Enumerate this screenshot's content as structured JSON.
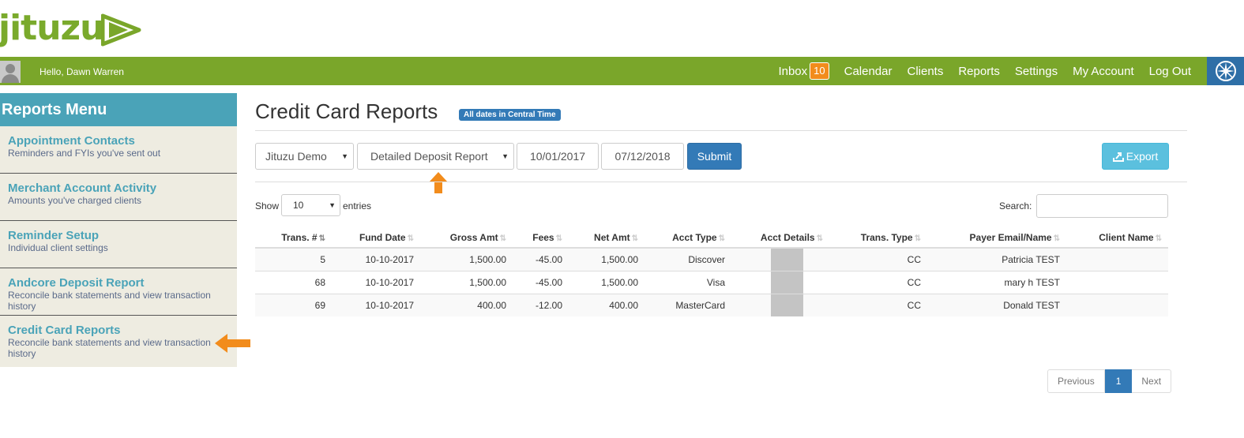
{
  "brand": {
    "logo_text": "jituzu",
    "accent": "#7aa62a"
  },
  "header": {
    "greeting": "Hello, Dawn Warren",
    "nav": [
      {
        "label": "Inbox",
        "badge": "10"
      },
      {
        "label": "Calendar"
      },
      {
        "label": "Clients"
      },
      {
        "label": "Reports"
      },
      {
        "label": "Settings"
      },
      {
        "label": "My Account"
      },
      {
        "label": "Log Out"
      }
    ],
    "help_icon": "compass-icon"
  },
  "sidebar": {
    "title": "Reports Menu",
    "items": [
      {
        "title": "Appointment Contacts",
        "desc": "Reminders and FYIs you've sent out"
      },
      {
        "title": "Merchant Account Activity",
        "desc": "Amounts you've charged clients"
      },
      {
        "title": "Reminder Setup",
        "desc": "Individual client settings"
      },
      {
        "title": "Andcore Deposit Report",
        "desc": "Reconcile bank statements and view transaction history"
      },
      {
        "title": "Credit Card Reports",
        "desc": "Reconcile bank statements and view transaction history"
      }
    ]
  },
  "main": {
    "title": "Credit Card Reports",
    "tz_label": "All dates in Central Time",
    "filters": {
      "account": "Jituzu Demo",
      "report_type": "Detailed Deposit Report",
      "start_date": "10/01/2017",
      "end_date": "07/12/2018",
      "submit": "Submit",
      "export": "Export"
    },
    "table_controls": {
      "show": "Show",
      "page_length": "10",
      "entries": "entries",
      "search": "Search:"
    },
    "table": {
      "columns": [
        "Trans. #",
        "Fund Date",
        "Gross Amt",
        "Fees",
        "Net Amt",
        "Acct Type",
        "Acct Details",
        "Trans. Type",
        "Payer Email/Name",
        "Client Name"
      ],
      "rows": [
        [
          "5",
          "10-10-2017",
          "1,500.00",
          "-45.00",
          "1,500.00",
          "Discover",
          "",
          "CC",
          "Patricia TEST",
          ""
        ],
        [
          "68",
          "10-10-2017",
          "1,500.00",
          "-45.00",
          "1,500.00",
          "Visa",
          "",
          "CC",
          "mary h TEST",
          ""
        ],
        [
          "69",
          "10-10-2017",
          "400.00",
          "-12.00",
          "400.00",
          "MasterCard",
          "",
          "CC",
          "Donald TEST",
          ""
        ]
      ]
    },
    "pagination": {
      "previous": "Previous",
      "current": "1",
      "next": "Next"
    }
  }
}
